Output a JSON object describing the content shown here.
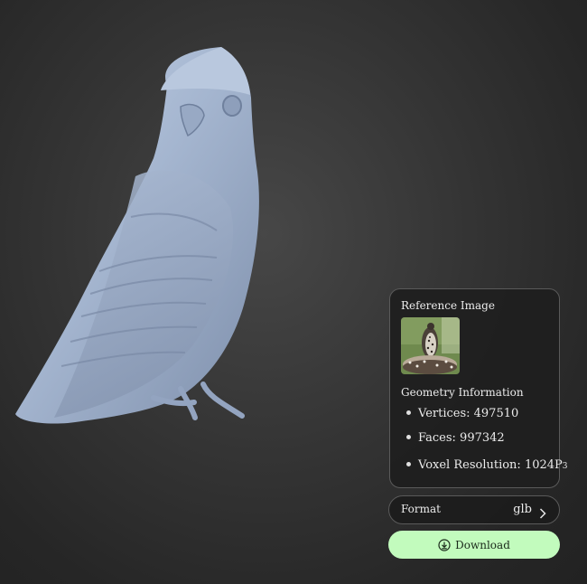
{
  "viewer": {
    "model_name": "bird-3d-model"
  },
  "panel": {
    "reference_title": "Reference Image",
    "geometry_title": "Geometry Information",
    "vertices": "Vertices: 497510",
    "faces": "Faces: 997342",
    "voxel_label": "Voxel Resolution: 1024P",
    "voxel_exp": "3"
  },
  "format": {
    "label": "Format",
    "value": "glb",
    "icon": "chevron-right-icon"
  },
  "download": {
    "label": "Download",
    "icon": "download-icon"
  },
  "colors": {
    "accent": "#c2fbbd",
    "model": "#a7b8d2",
    "background": "#2e2e2e"
  }
}
